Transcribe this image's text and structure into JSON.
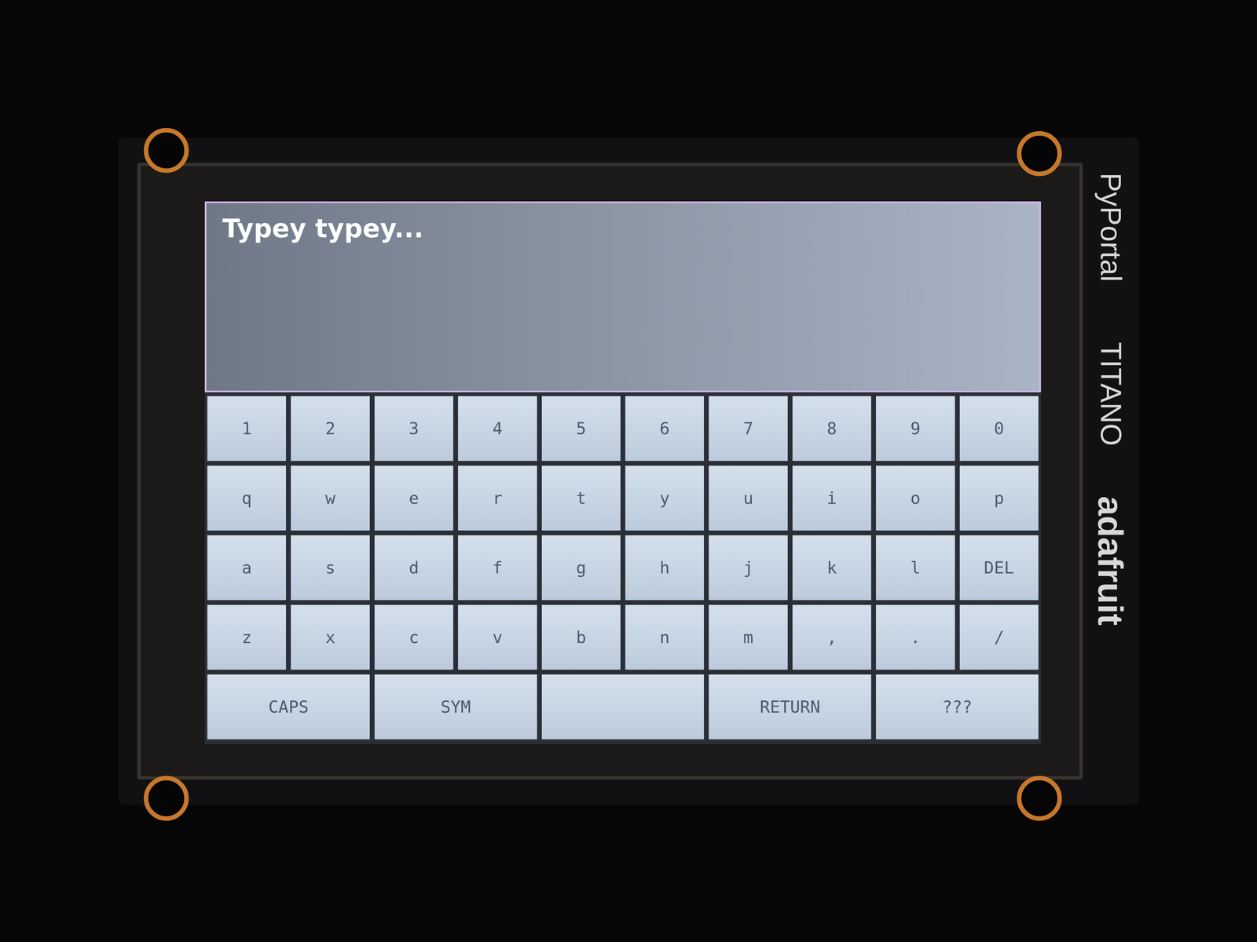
{
  "text_area": {
    "text": "Typey typey..."
  },
  "keyboard": {
    "rows": [
      [
        "1",
        "2",
        "3",
        "4",
        "5",
        "6",
        "7",
        "8",
        "9",
        "0"
      ],
      [
        "q",
        "w",
        "e",
        "r",
        "t",
        "y",
        "u",
        "i",
        "o",
        "p"
      ],
      [
        "a",
        "s",
        "d",
        "f",
        "g",
        "h",
        "j",
        "k",
        "l",
        "DEL"
      ],
      [
        "z",
        "x",
        "c",
        "v",
        "b",
        "n",
        "m",
        ",",
        ".",
        "/"
      ]
    ],
    "bottom_row": [
      {
        "label": "CAPS"
      },
      {
        "label": "SYM"
      },
      {
        "label": ""
      },
      {
        "label": "RETURN"
      },
      {
        "label": "???"
      }
    ]
  },
  "board": {
    "labels": [
      "PyPortal",
      "TITANO",
      "adafruit"
    ]
  }
}
